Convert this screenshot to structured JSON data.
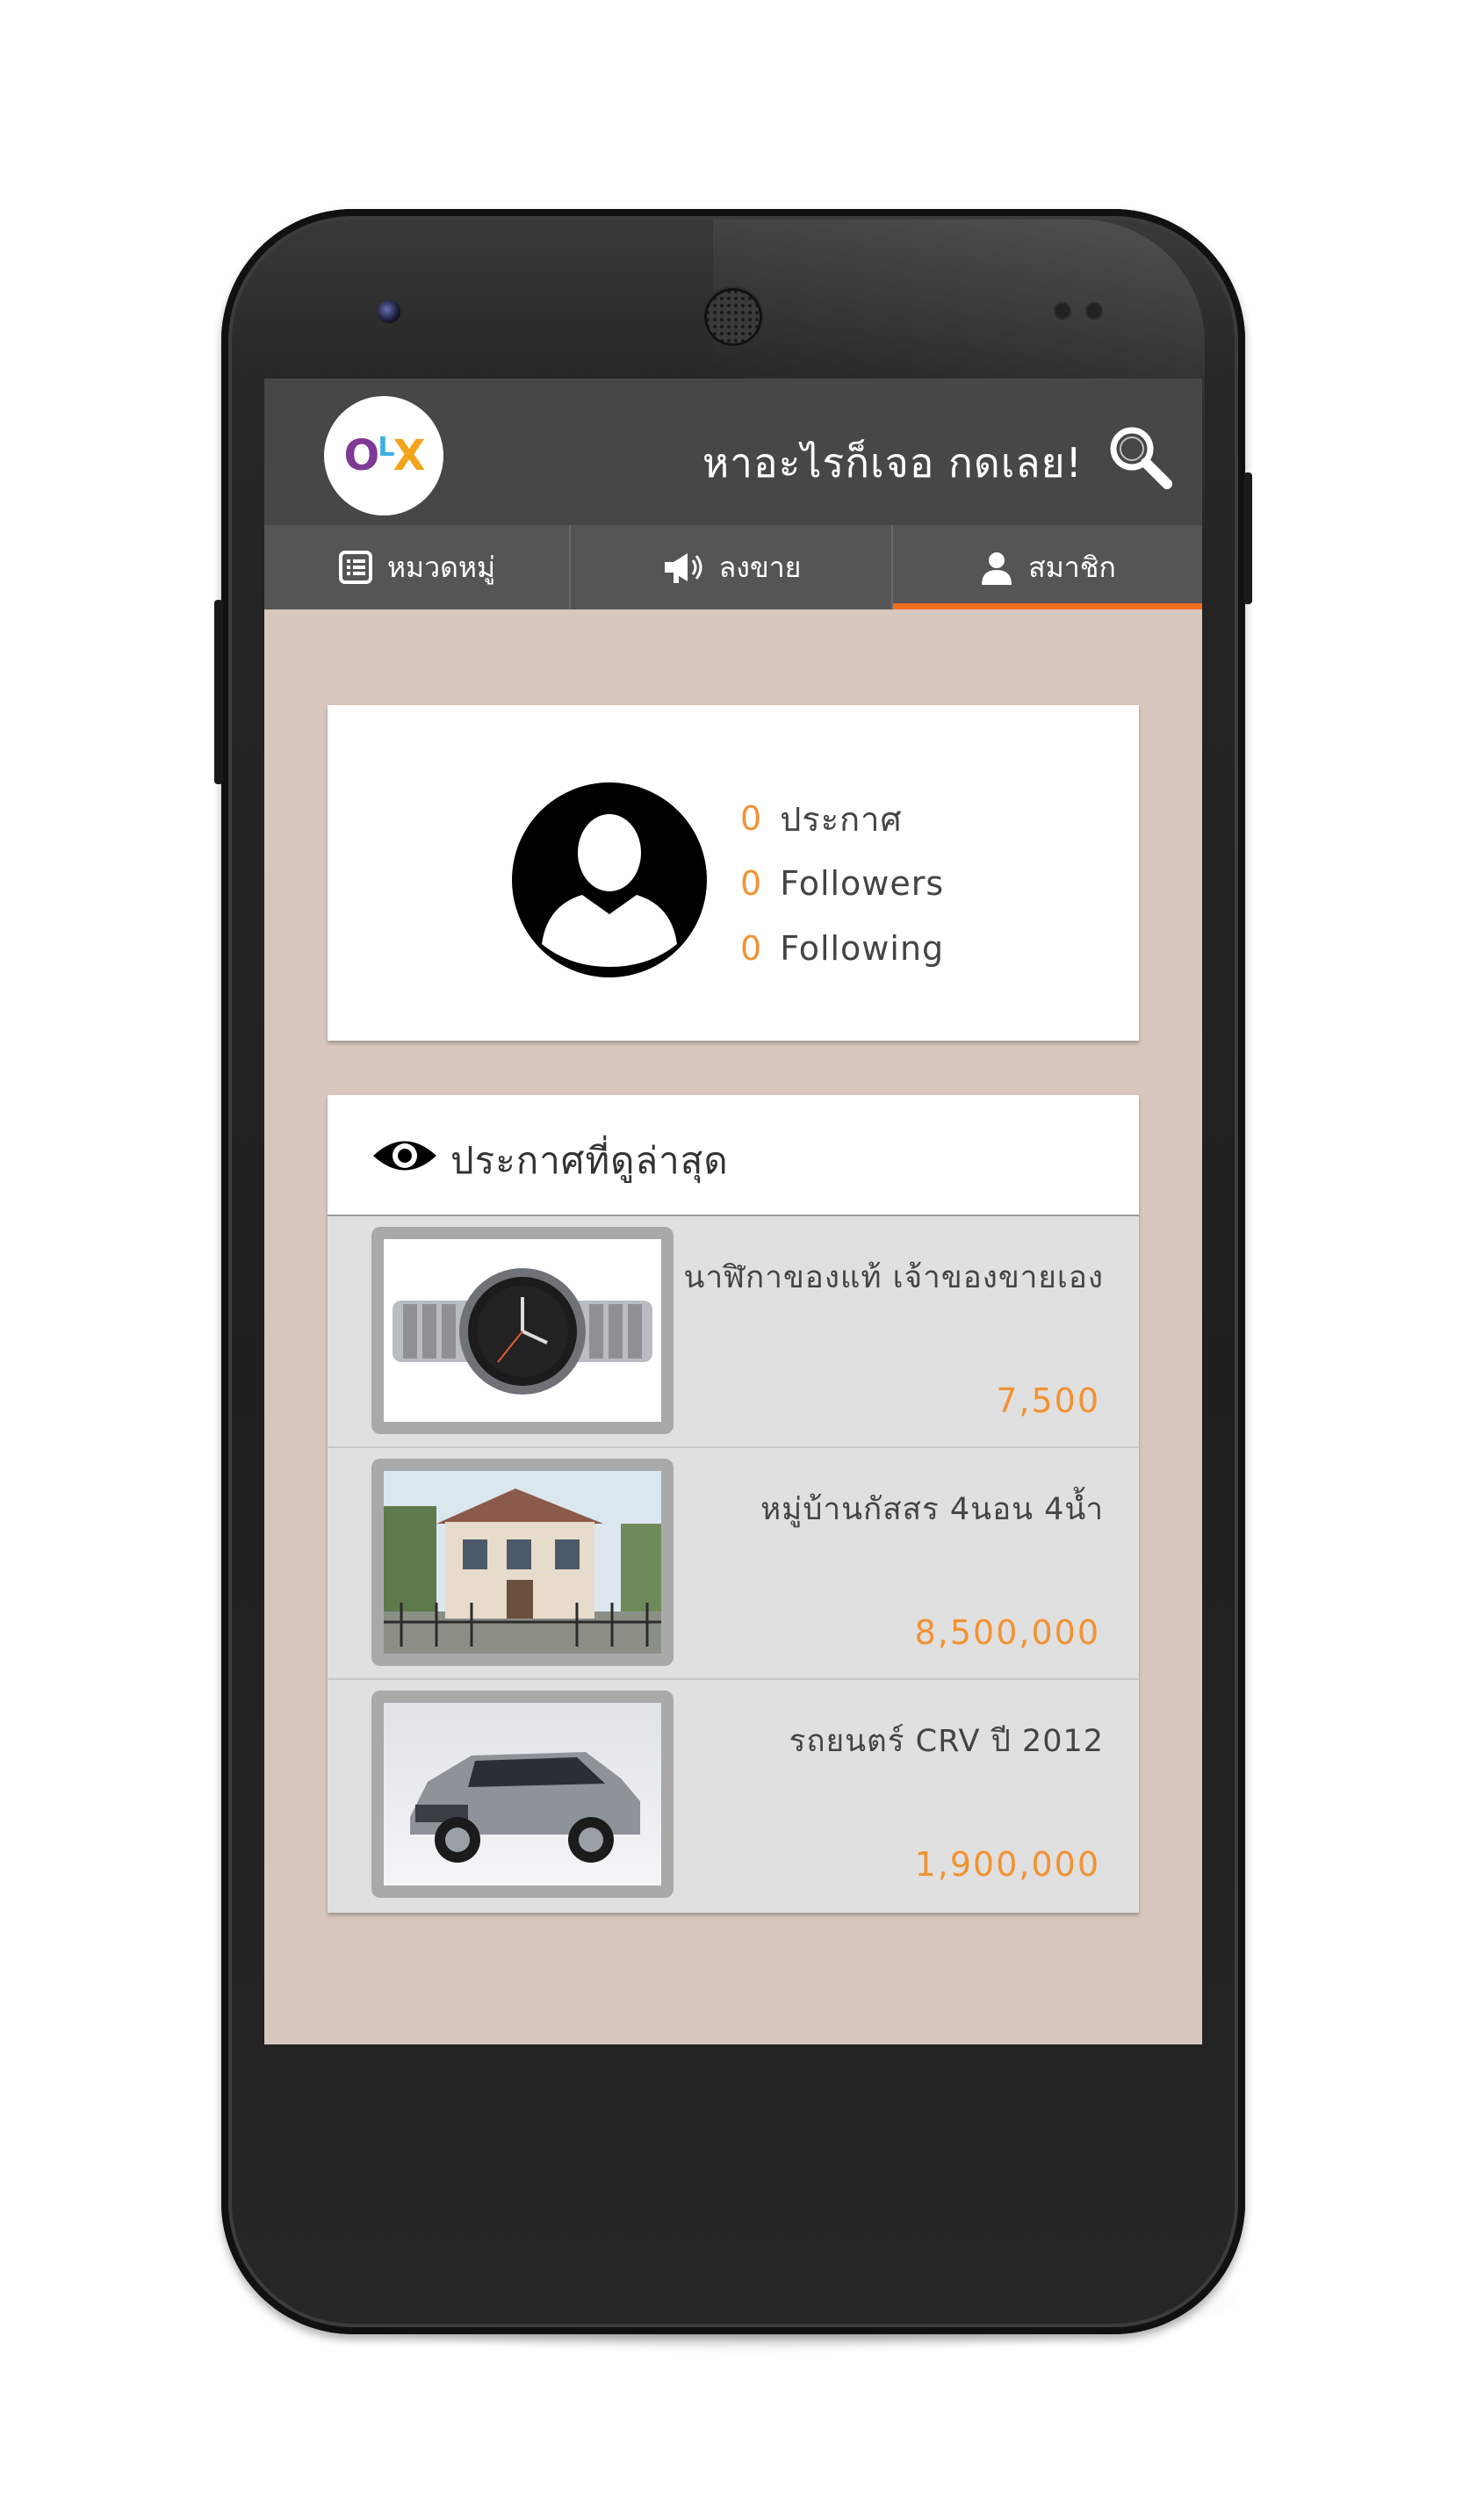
{
  "app": {
    "name": "OLX"
  },
  "topbar": {
    "logo": {
      "o": "O",
      "l": "L",
      "x": "X"
    },
    "search_prompt": "หาอะไรก็เจอ กดเลย!",
    "search_icon": "search-icon"
  },
  "tabs": [
    {
      "label": "หมวดหมู่",
      "icon": "list-icon",
      "active": false
    },
    {
      "label": "ลงขาย",
      "icon": "megaphone-icon",
      "active": false
    },
    {
      "label": "สมาชิก",
      "icon": "user-icon",
      "active": true
    }
  ],
  "profile": {
    "stats": [
      {
        "value": "0",
        "label": "ประกาศ"
      },
      {
        "value": "0",
        "label": "Followers"
      },
      {
        "value": "0",
        "label": "Following"
      }
    ]
  },
  "recent": {
    "title": "ประกาศที่ดูล่าสุด",
    "items": [
      {
        "title": "นาฬิกาของแท้ เจ้าของขายเอง",
        "price": "7,500",
        "image": "watch"
      },
      {
        "title": "หมู่บ้านกัสสร 4นอน 4น้ำ",
        "price": "8,500,000",
        "image": "house"
      },
      {
        "title": "รถยนตร์ CRV ปี 2012",
        "price": "1,900,000",
        "image": "car"
      }
    ]
  },
  "colors": {
    "accent": "#f37021",
    "price": "#f39233",
    "topbar": "#474747",
    "tabbar": "#555555",
    "screen_bg": "#d8c7be"
  }
}
